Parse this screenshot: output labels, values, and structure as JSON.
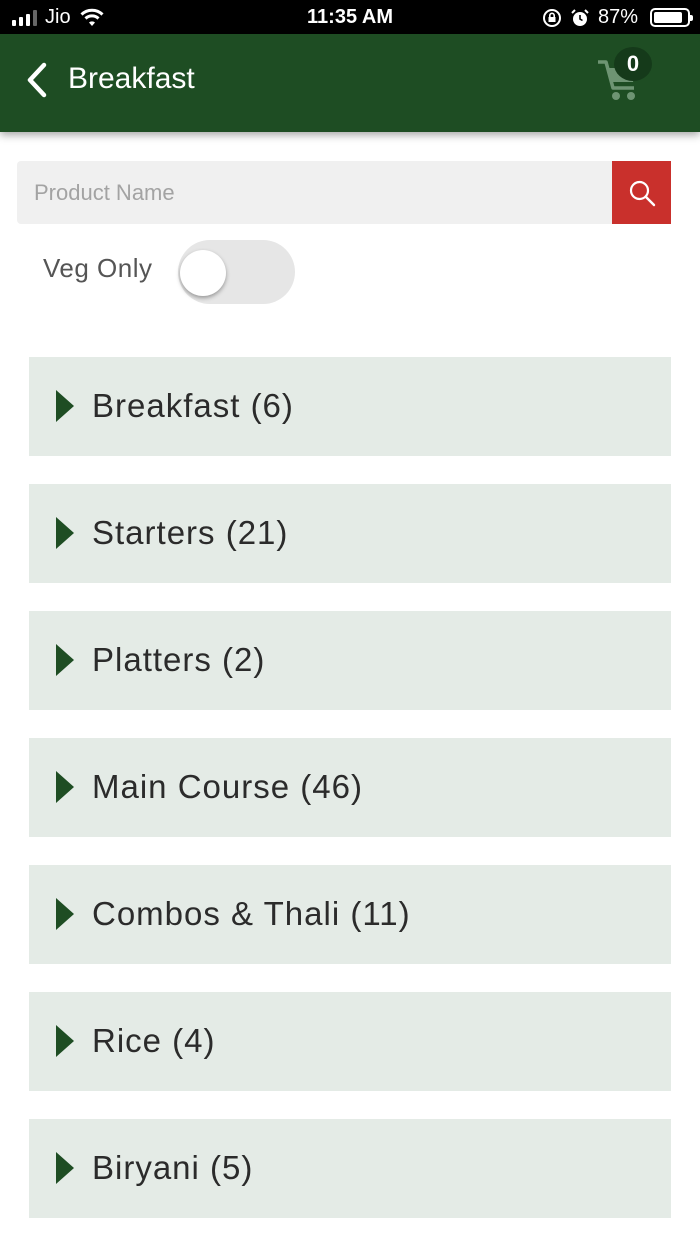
{
  "status_bar": {
    "carrier": "Jio",
    "time": "11:35 AM",
    "battery": "87%",
    "battery_level": 0.87
  },
  "header": {
    "title": "Breakfast",
    "cart_count": "0"
  },
  "search": {
    "placeholder": "Product Name"
  },
  "veg_filter": {
    "label": "Veg Only",
    "enabled": false
  },
  "categories": [
    {
      "label": "Breakfast (6)"
    },
    {
      "label": "Starters (21)"
    },
    {
      "label": "Platters (2)"
    },
    {
      "label": "Main Course (46)"
    },
    {
      "label": "Combos & Thali (11)"
    },
    {
      "label": "Rice (4)"
    },
    {
      "label": "Biryani (5)"
    }
  ],
  "colors": {
    "header_bg": "#1e4d23",
    "search_button": "#c9302c",
    "category_bg": "#e4ebe6",
    "arrow": "#1e4d23"
  },
  "icons": {
    "back": "chevron-left-icon",
    "cart": "shopping-cart-icon",
    "search": "search-icon",
    "category_expand": "caret-right-icon"
  }
}
